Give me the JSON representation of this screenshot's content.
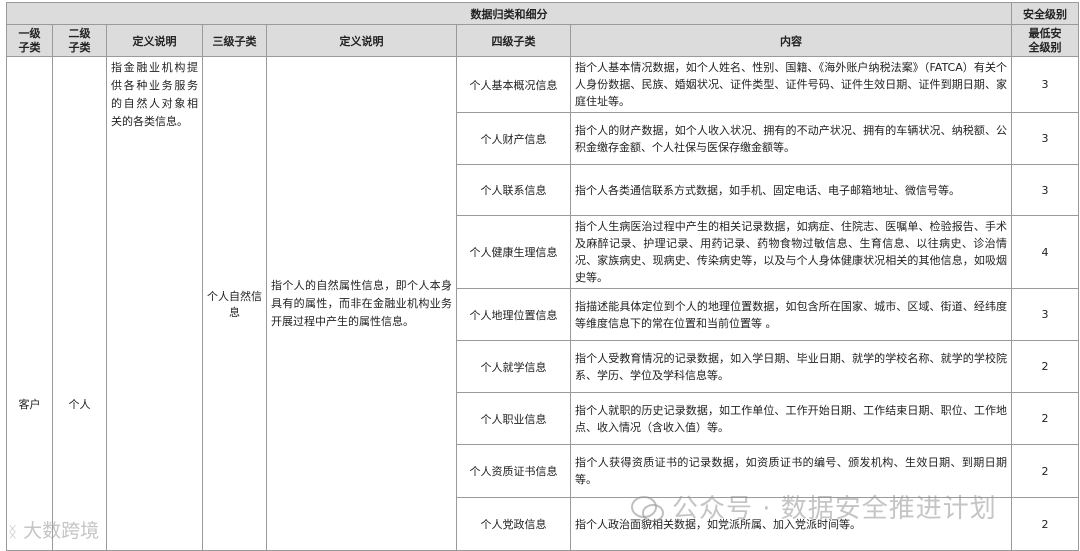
{
  "header": {
    "group_title": "数据归类和细分",
    "security_title": "安全级别",
    "columns": {
      "level1": "一级\n子类",
      "level2": "二级\n子类",
      "def1": "定义说明",
      "level3": "三级子类",
      "def2": "定义说明",
      "level4": "四级子类",
      "content": "内容",
      "min_level": "最低安\n全级别"
    }
  },
  "level1": "客户",
  "level2": "个人",
  "level2_def": "指金融业机构提供各种业务服务的自然人对象相关的各类信息。",
  "level3": "个人自然信息",
  "level3_def": "指个人的自然属性信息，即个人本身具有的属性，而非在金融业机构业务开展过程中产生的属性信息。",
  "rows": [
    {
      "name": "个人基本概况信息",
      "content": "指个人基本情况数据，如个人姓名、性别、国籍、《海外账户纳税法案》（FATCA）有关个人身份数据、民族、婚姻状况、证件类型、证件号码、证件生效日期、证件到期日期、家庭住址等。",
      "level": "3"
    },
    {
      "name": "个人财产信息",
      "content": "指个人的财产数据，如个人收入状况、拥有的不动产状况、拥有的车辆状况、纳税额、公积金缴存金额、个人社保与医保存缴金额等。",
      "level": "3"
    },
    {
      "name": "个人联系信息",
      "content": "指个人各类通信联系方式数据，如手机、固定电话、电子邮箱地址、微信号等。",
      "level": "3"
    },
    {
      "name": "个人健康生理信息",
      "content": "指个人生病医治过程中产生的相关记录数据，如病症、住院志、医嘱单、检验报告、手术及麻醉记录、护理记录、用药记录、药物食物过敏信息、生育信息、以往病史、诊治情况、家族病史、现病史、传染病史等，以及与个人身体健康状况相关的其他信息，如吸烟史等。",
      "level": "4"
    },
    {
      "name": "个人地理位置信息",
      "content": "指描述能具体定位到个人的地理位置数据，如包含所在国家、城市、区域、街道、经纬度等维度信息下的常在位置和当前位置等 。",
      "level": "3"
    },
    {
      "name": "个人就学信息",
      "content": "指个人受教育情况的记录数据，如入学日期、毕业日期、就学的学校名称、就学的学校院系、学历、学位及学科信息等。",
      "level": "2"
    },
    {
      "name": "个人职业信息",
      "content": "指个人就职的历史记录数据，如工作单位、工作开始日期、工作结束日期、职位、工作地点、收入情况（含收入值）等。",
      "level": "2"
    },
    {
      "name": "个人资质证书信息",
      "content": "指个人获得资质证书的记录数据，如资质证书的编号、颁发机构、生效日期、到期日期等。",
      "level": "2"
    },
    {
      "name": "个人党政信息",
      "content": "指个人政治面貌相关数据，如党派所属、加入党派时间等。",
      "level": "2"
    }
  ],
  "watermarks": {
    "wechat": "公众号 · 数据安全推进计划",
    "brand": "大数跨境"
  }
}
